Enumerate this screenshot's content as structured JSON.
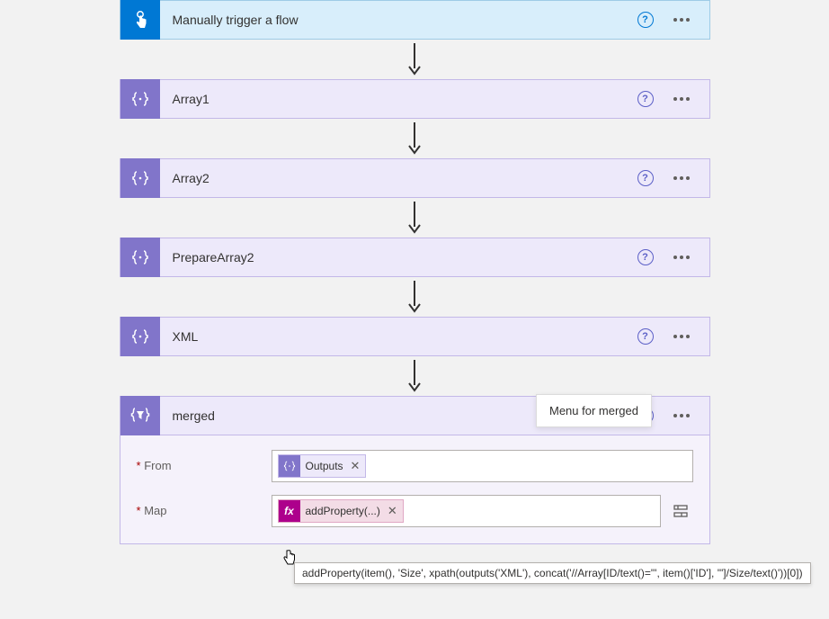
{
  "colors": {
    "trigger_bg": "#d8eefb",
    "trigger_icon": "#0078d4",
    "action_bg": "#ede9fa",
    "action_icon": "#8175ca",
    "fx_icon": "#ad008c",
    "help": "#5b5fc7"
  },
  "trigger": {
    "title": "Manually trigger a flow"
  },
  "steps": [
    {
      "title": "Array1"
    },
    {
      "title": "Array2"
    },
    {
      "title": "PrepareArray2"
    },
    {
      "title": "XML"
    }
  ],
  "merged": {
    "title": "merged",
    "from_label": "From",
    "map_label": "Map",
    "from_token": "Outputs",
    "map_token": "addProperty(...)",
    "fx_label": "fx"
  },
  "tooltips": {
    "menu": "Menu for merged",
    "expression": "addProperty(item(), 'Size', xpath(outputs('XML'), concat('//Array[ID/text()=\"', item()['ID'], '\"]/Size/text()'))[0])"
  }
}
